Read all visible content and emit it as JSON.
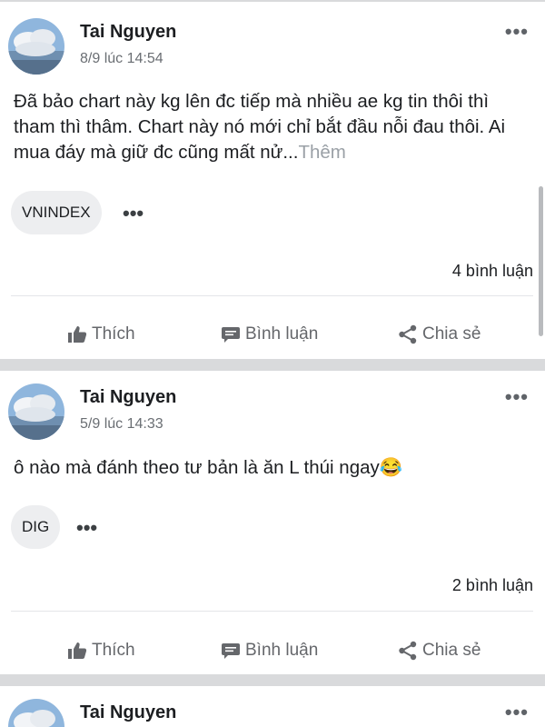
{
  "posts": [
    {
      "author": "Tai Nguyen",
      "time": "8/9 lúc 14:54",
      "text": "Đã bảo chart này kg lên đc tiếp mà nhiều ae kg tin thôi thì tham thì thâm. Chart này nó mới chỉ bắt đầu nỗi đau thôi. Ai mua đáy mà giữ đc cũng mất nử...",
      "see_more": "Thêm",
      "tag": "VNINDEX",
      "comments": "4 bình luận"
    },
    {
      "author": "Tai Nguyen",
      "time": "5/9 lúc 14:33",
      "text": "ô nào mà đánh theo tư bản là ăn L thúi ngay",
      "emoji": "😂",
      "tag": "DIG",
      "comments": "2 bình luận"
    },
    {
      "author": "Tai Nguyen"
    }
  ],
  "actions": {
    "like": "Thích",
    "comment": "Bình luận",
    "share": "Chia sẻ"
  },
  "more_glyph": "•••",
  "tag_more_glyph": "•••",
  "icons": {
    "like": "thumbs-up-icon",
    "comment": "comment-icon",
    "share": "share-icon",
    "more": "more-icon"
  },
  "colors": {
    "text": "#1c1e21",
    "muted": "#65676b",
    "feed_bg": "#d9dadc",
    "tag_bg": "#edeef0"
  }
}
